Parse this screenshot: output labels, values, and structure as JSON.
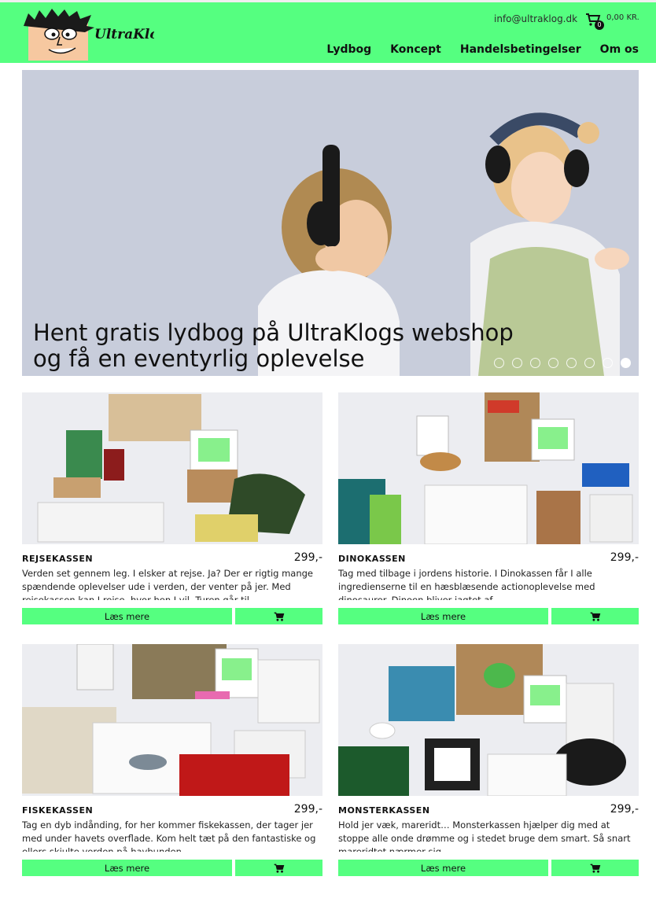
{
  "header": {
    "brand": "UltraKlog",
    "email": "info@ultraklog.dk",
    "cart_count": "0",
    "cart_total": "0,00 KR.",
    "nav": [
      "Lydbog",
      "Koncept",
      "Handelsbetingelser",
      "Om os"
    ],
    "accent": "#55ff80"
  },
  "hero": {
    "caption_line1": "Hent gratis lydbog på UltraKlogs webshop",
    "caption_line2": "og få en eventyrlig oplevelse",
    "slides": 8,
    "active_slide": 8
  },
  "products": [
    {
      "name": "REJSEKASSEN",
      "price": "299,-",
      "desc": "Verden set gennem leg. I elsker at rejse. Ja? Der er rigtig mange spændende oplevelser ude i verden, der venter på jer. Med rejsekassen kan I rejse, hvor hen I vil. Turen går til",
      "more_label": "Læs mere",
      "cart_icon": "cart-icon"
    },
    {
      "name": "DINOKASSEN",
      "price": "299,-",
      "desc": "Tag med tilbage i jordens historie. I Dinokassen får I alle ingredienserne til en hæsblæsende actionoplevelse med dinosaurer. Dinoen bliver jagtet af",
      "more_label": "Læs mere",
      "cart_icon": "cart-icon"
    },
    {
      "name": "FISKEKASSEN",
      "price": "299,-",
      "desc": "Tag en dyb indånding, for her kommer fiskekassen, der tager jer med under havets overflade. Kom helt tæt på den fantastiske og ellers skjulte verden på havbunden",
      "more_label": "Læs mere",
      "cart_icon": "cart-icon"
    },
    {
      "name": "MONSTERKASSEN",
      "price": "299,-",
      "desc": "Hold jer væk, mareridt… Monsterkassen hjælper dig med at stoppe alle onde drømme og i stedet bruge dem smart. Så snart mareridtet nærmer sig",
      "more_label": "Læs mere",
      "cart_icon": "cart-icon"
    }
  ]
}
